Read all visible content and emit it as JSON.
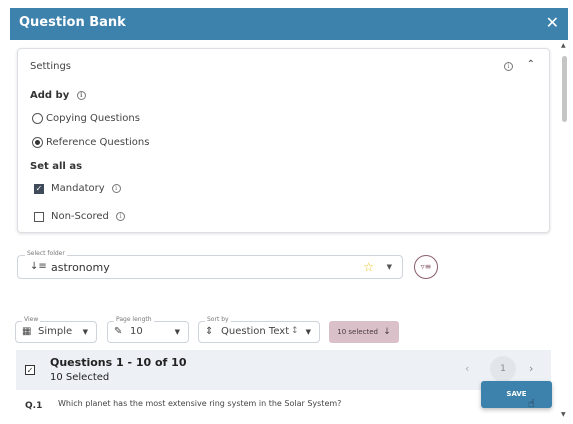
{
  "dialog": {
    "title": "Question Bank",
    "close_glyph": "✕"
  },
  "settings": {
    "title": "Settings",
    "add_by_label": "Add by",
    "add_by_options": [
      {
        "label": "Copying Questions",
        "selected": false
      },
      {
        "label": "Reference Questions",
        "selected": true
      }
    ],
    "set_all_as_label": "Set all as",
    "set_all_options": [
      {
        "label": "Mandatory",
        "checked": true
      },
      {
        "label": "Non-Scored",
        "checked": false
      }
    ]
  },
  "folder": {
    "legend": "Select folder",
    "value": "astronomy"
  },
  "controls": {
    "view": {
      "legend": "View",
      "value": "Simple"
    },
    "page_length": {
      "legend": "Page length",
      "value": "10"
    },
    "sort_by": {
      "legend": "Sort by",
      "value": "Question Text"
    },
    "selected_button": "10 selected"
  },
  "questions": {
    "range_label": "Questions 1 - 10 of 10",
    "selected_label": "10 Selected",
    "current_page": "1",
    "items": [
      {
        "number": "Q.1",
        "text": "Which planet has the most extensive ring system in the Solar System?"
      }
    ]
  },
  "save_label": "SAVE",
  "colors": {
    "header": "#3d81ad",
    "selected_button": "#d9c0c9",
    "star": "#f0c21a"
  },
  "icons": [
    "close-icon",
    "info-icon",
    "chevron-up-icon",
    "sort-icon",
    "star-icon",
    "filter-icon",
    "grid-icon",
    "ruler-icon",
    "sort-arrows-icon",
    "arrow-down-icon",
    "chevron-left-icon",
    "chevron-right-icon"
  ]
}
